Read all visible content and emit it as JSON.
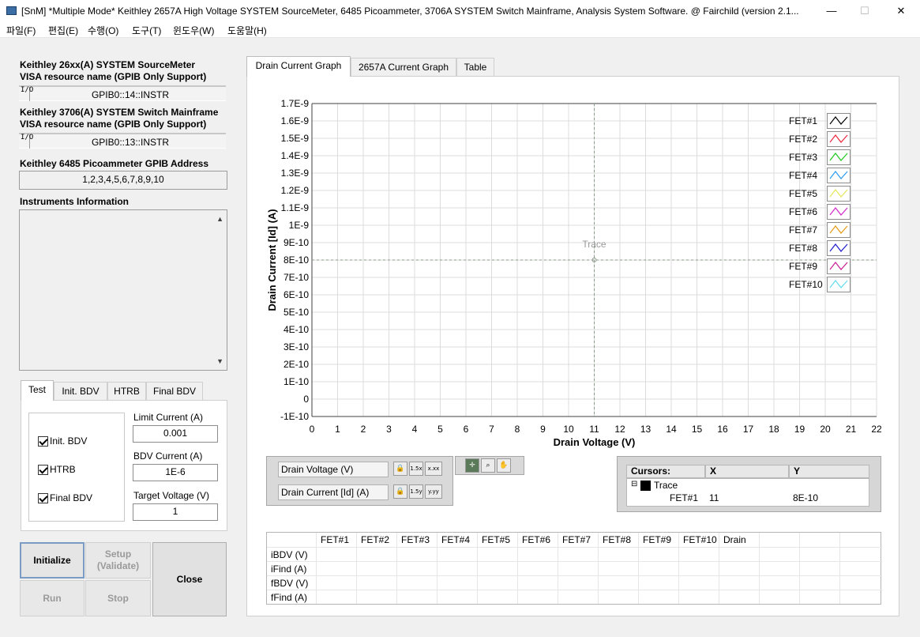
{
  "window": {
    "title": "[SnM] *Multiple Mode* Keithley 2657A High Voltage SYSTEM SourceMeter, 6485 Picoammeter, 3706A SYSTEM Switch Mainframe, Analysis System Software. @ Fairchild (version 2.1...",
    "minimize_glyph": "—",
    "maximize_glyph": "☐",
    "close_glyph": "✕"
  },
  "menu": [
    "파일(F)",
    "편집(E)",
    "수행(O)",
    "도구(T)",
    "윈도우(W)",
    "도움말(H)"
  ],
  "left": {
    "smu_label_1": "Keithley 26xx(A) SYSTEM SourceMeter",
    "smu_label_2": "VISA resource name (GPIB Only Support)",
    "smu_resource": "GPIB0::14::INSTR",
    "switch_label_1": "Keithley 3706(A) SYSTEM Switch Mainframe",
    "switch_label_2": "VISA resource name (GPIB Only Support)",
    "switch_resource": "GPIB0::13::INSTR",
    "pico_label": "Keithley 6485 Picoammeter GPIB Address",
    "pico_address": "1,2,3,4,5,6,7,8,9,10",
    "info_label": "Instruments Information",
    "io_glyph": "I/O",
    "scroll_up": "▲",
    "scroll_down": "▼"
  },
  "settings_tabs": [
    "Test",
    "Init. BDV",
    "HTRB",
    "Final BDV"
  ],
  "test_panel": {
    "checks": [
      {
        "label": "Init. BDV",
        "checked": true
      },
      {
        "label": "HTRB",
        "checked": true
      },
      {
        "label": "Final BDV",
        "checked": true
      }
    ],
    "limit_current_label": "Limit Current (A)",
    "limit_current": "0.001",
    "bdv_current_label": "BDV Current (A)",
    "bdv_current": "1E-6",
    "target_voltage_label": "Target Voltage (V)",
    "target_voltage": "1"
  },
  "buttons": {
    "initialize": "Initialize",
    "setup": "Setup\n(Validate)",
    "close": "Close",
    "run": "Run",
    "stop": "Stop"
  },
  "graph_tabs": [
    "Drain Current Graph",
    "2657A Current Graph",
    "Table"
  ],
  "chart_data": {
    "type": "line",
    "xlabel": "Drain Voltage (V)",
    "ylabel": "Drain Current [Id] (A)",
    "xlim": [
      0,
      22
    ],
    "ylim": [
      -1e-10,
      1.7e-09
    ],
    "x_ticks": [
      "0",
      "1",
      "2",
      "3",
      "4",
      "5",
      "6",
      "7",
      "8",
      "9",
      "10",
      "11",
      "12",
      "13",
      "14",
      "15",
      "16",
      "17",
      "18",
      "19",
      "20",
      "21",
      "22"
    ],
    "y_ticks": [
      "1.7E-9",
      "1.6E-9",
      "1.5E-9",
      "1.4E-9",
      "1.3E-9",
      "1.2E-9",
      "1.1E-9",
      "1E-9",
      "9E-10",
      "8E-10",
      "7E-10",
      "6E-10",
      "5E-10",
      "4E-10",
      "3E-10",
      "2E-10",
      "1E-10",
      "0",
      "-1E-10"
    ],
    "grid": true,
    "legend_position": "top-right",
    "series": [
      {
        "name": "FET#1",
        "color": "#000000",
        "values": []
      },
      {
        "name": "FET#2",
        "color": "#e8283c",
        "values": []
      },
      {
        "name": "FET#3",
        "color": "#1ec81e",
        "values": []
      },
      {
        "name": "FET#4",
        "color": "#2d9cf0",
        "values": []
      },
      {
        "name": "FET#5",
        "color": "#e6e65a",
        "values": []
      },
      {
        "name": "FET#6",
        "color": "#d228c8",
        "values": []
      },
      {
        "name": "FET#7",
        "color": "#e69b14",
        "values": []
      },
      {
        "name": "FET#8",
        "color": "#1e1ecc",
        "values": []
      },
      {
        "name": "FET#9",
        "color": "#c81e96",
        "values": []
      },
      {
        "name": "FET#10",
        "color": "#64dcf0",
        "values": []
      }
    ],
    "cursor": {
      "label": "Trace",
      "x": 11,
      "y": 8e-10
    }
  },
  "axis_controls": {
    "x_name": "Drain Voltage (V)",
    "y_name": "Drain Current [Id] (A)",
    "lock_icon": "🔒",
    "x_scale_glyph": "1.5x",
    "y_scale_glyph": "1.5y",
    "x_fmt_glyph": "x.xx",
    "y_fmt_glyph": "y.yy"
  },
  "palette_icons": [
    "crosshair-icon",
    "zoom-icon",
    "pan-icon"
  ],
  "cursor_table": {
    "headers": [
      "Cursors:",
      "X",
      "Y"
    ],
    "trace_label": "Trace",
    "expand_glyph": "⊟",
    "row": {
      "name": "FET#1",
      "x": "11",
      "y": "8E-10"
    }
  },
  "results_table": {
    "columns": [
      "FET#1",
      "FET#2",
      "FET#3",
      "FET#4",
      "FET#5",
      "FET#6",
      "FET#7",
      "FET#8",
      "FET#9",
      "FET#10",
      "Drain"
    ],
    "rows": [
      "iBDV (V)",
      "iFind (A)",
      "fBDV (V)",
      "fFind (A)"
    ]
  }
}
